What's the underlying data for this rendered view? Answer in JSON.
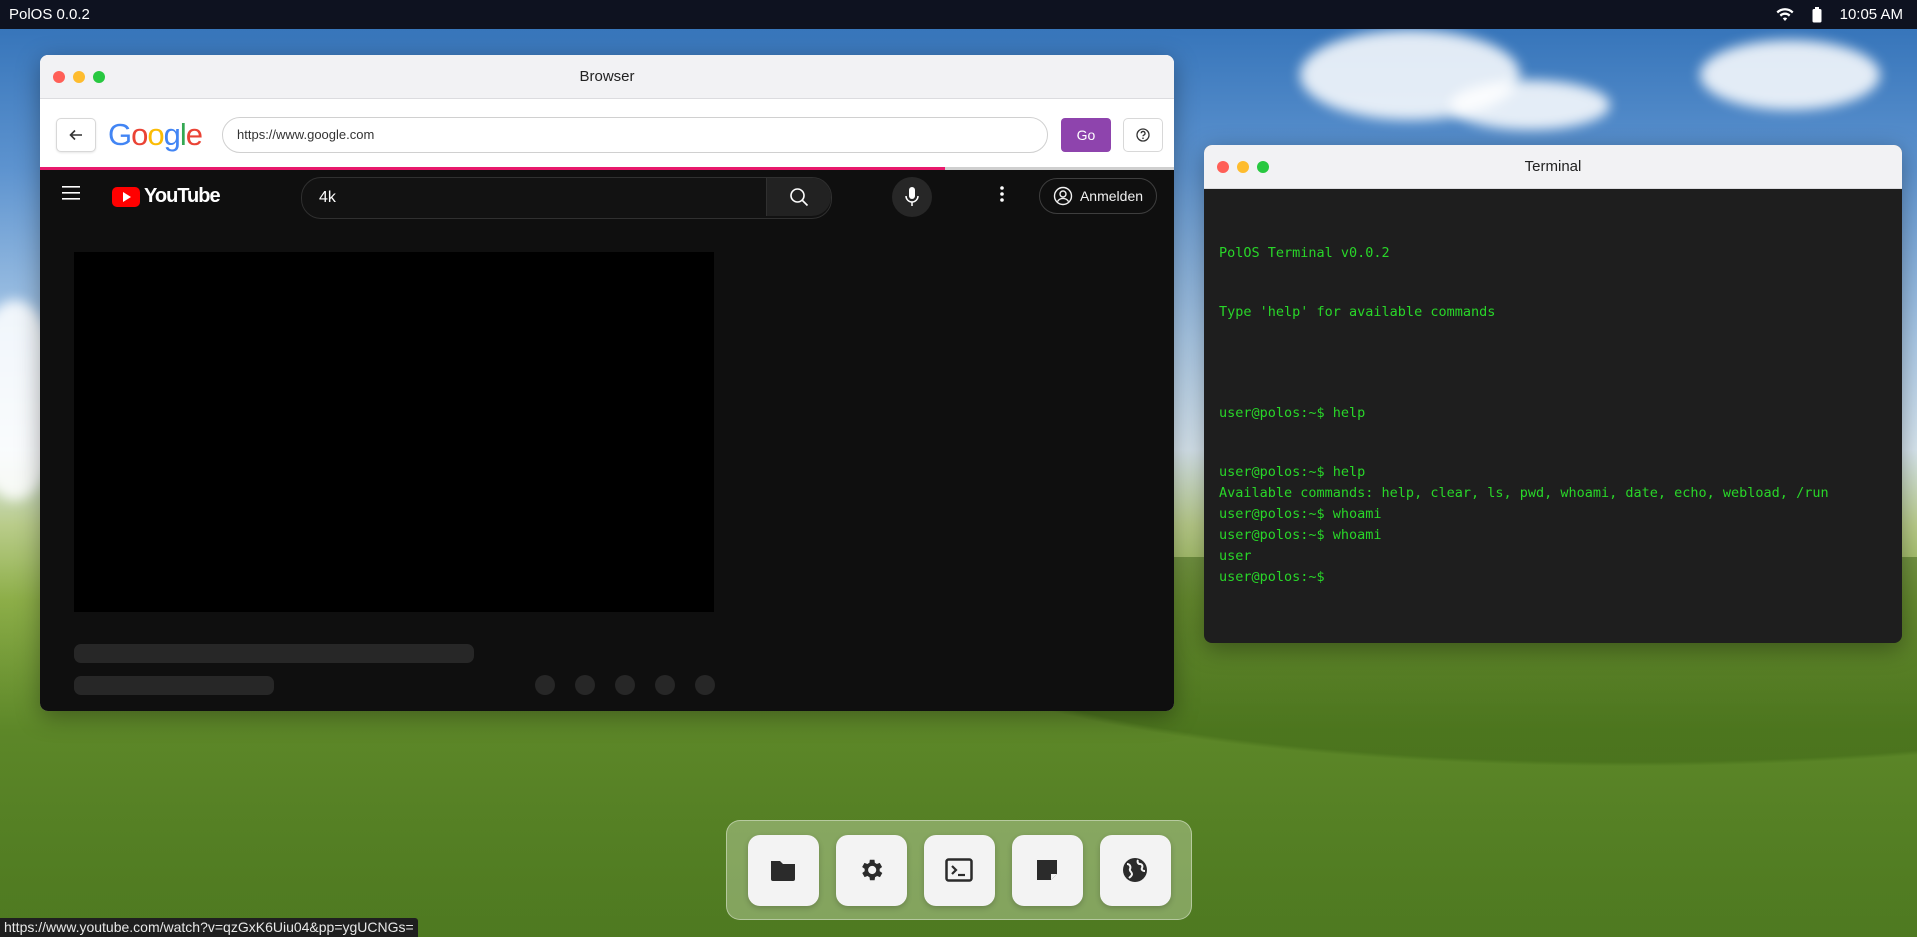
{
  "topbar": {
    "os_name": "PolOS 0.0.2",
    "time": "10:05 AM",
    "icons": [
      "wifi-icon",
      "battery-icon"
    ]
  },
  "browser": {
    "title": "Browser",
    "logo_text": "Google",
    "url": "https://www.google.com",
    "go_label": "Go",
    "page": {
      "site": "YouTube",
      "search_value": "4k",
      "signin_label": "Anmelden"
    }
  },
  "terminal": {
    "title": "Terminal",
    "lines": [
      "PolOS Terminal v0.0.2",
      "Type 'help' for available commands",
      "user@polos:~$ help",
      "user@polos:~$ help",
      "Available commands: help, clear, ls, pwd, whoami, date, echo, webload, /run",
      "user@polos:~$ whoami",
      "user@polos:~$ whoami",
      "user",
      "user@polos:~$"
    ]
  },
  "dock": {
    "items": [
      "folder-icon",
      "gear-icon",
      "terminal-icon",
      "notes-icon",
      "globe-icon"
    ]
  },
  "statusbar": {
    "link": "https://www.youtube.com/watch?v=qzGxK6Uiu04&pp=ygUCNGs="
  }
}
